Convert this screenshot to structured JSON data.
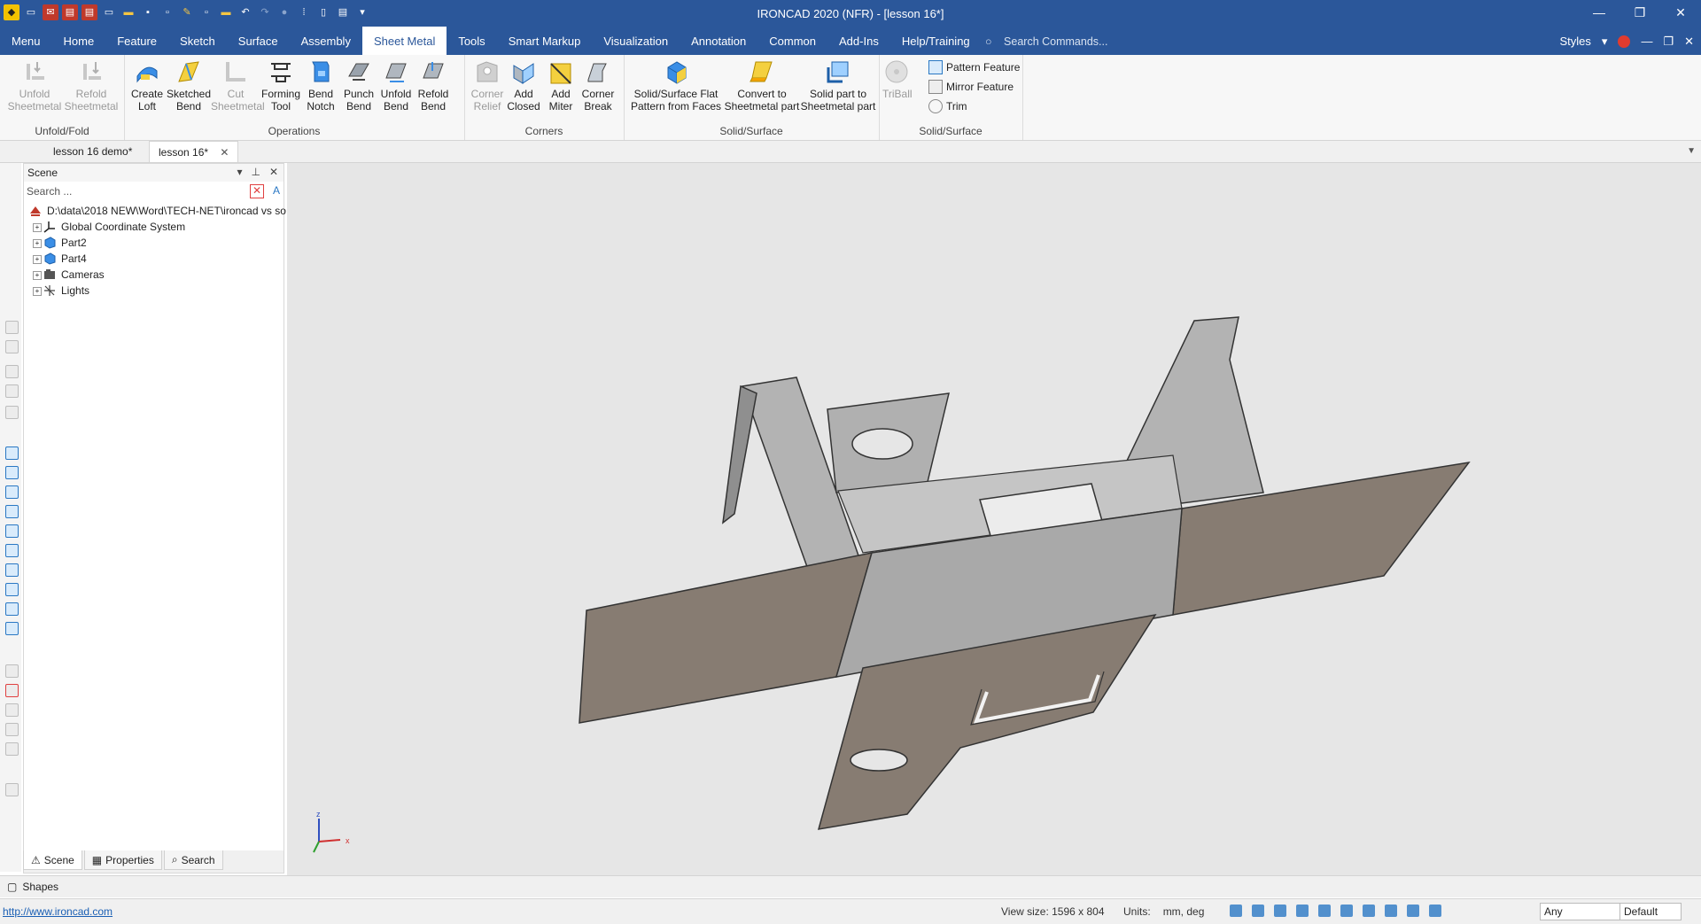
{
  "window": {
    "title": "IRONCAD 2020 (NFR) - [lesson 16*]",
    "controls": [
      "—",
      "❐",
      "✕"
    ]
  },
  "menu": {
    "tabs": [
      {
        "label": "Menu"
      },
      {
        "label": "Home"
      },
      {
        "label": "Feature"
      },
      {
        "label": "Sketch"
      },
      {
        "label": "Surface"
      },
      {
        "label": "Assembly"
      },
      {
        "label": "Sheet Metal"
      },
      {
        "label": "Tools"
      },
      {
        "label": "Smart Markup"
      },
      {
        "label": "Visualization"
      },
      {
        "label": "Annotation"
      },
      {
        "label": "Common"
      },
      {
        "label": "Add-Ins"
      },
      {
        "label": "Help/Training"
      }
    ],
    "active_tab": "Sheet Metal",
    "search_placeholder": "Search Commands...",
    "styles_label": "Styles"
  },
  "ribbon": {
    "groups": {
      "unfold_fold": "Unfold/Fold",
      "operations": "Operations",
      "corners": "Corners",
      "solid_surface_1": "Solid/Surface",
      "solid_surface_2": "Solid/Surface"
    },
    "buttons": {
      "unfold_sheetmetal": [
        "Unfold",
        "Sheetmetal"
      ],
      "refold_sheetmetal": [
        "Refold",
        "Sheetmetal"
      ],
      "create_loft": [
        "Create",
        "Loft"
      ],
      "sketched_bend": [
        "Sketched",
        "Bend"
      ],
      "cut_sheetmetal": [
        "Cut",
        "Sheetmetal"
      ],
      "forming_tool": [
        "Forming",
        "Tool"
      ],
      "bend_notch": [
        "Bend",
        "Notch"
      ],
      "punch_bend": [
        "Punch",
        "Bend"
      ],
      "unfold_bend": [
        "Unfold",
        "Bend"
      ],
      "refold_bend": [
        "Refold",
        "Bend"
      ],
      "corner_relief": [
        "Corner",
        "Relief"
      ],
      "add_closed": [
        "Add",
        "Closed"
      ],
      "add_miter": [
        "Add",
        "Miter"
      ],
      "corner_break": [
        "Corner",
        "Break"
      ],
      "flat_pattern": [
        "Solid/Surface Flat",
        "Pattern from Faces"
      ],
      "convert_sheetmetal": [
        "Convert to",
        "Sheetmetal part"
      ],
      "solid_to_sheetmetal": [
        "Solid part to",
        "Sheetmetal part"
      ],
      "triball": "TriBall",
      "pattern_feature": "Pattern Feature",
      "mirror_feature": "Mirror Feature",
      "trim": "Trim"
    }
  },
  "doc_tabs": [
    {
      "label": "lesson 16 demo*"
    },
    {
      "label": "lesson 16*"
    }
  ],
  "scene": {
    "title": "Scene",
    "search_placeholder": "Search ...",
    "root": "D:\\data\\2018 NEW\\Word\\TECH-NET\\ironcad vs so",
    "items": [
      {
        "label": "Global Coordinate System"
      },
      {
        "label": "Part2"
      },
      {
        "label": "Part4"
      },
      {
        "label": "Cameras"
      },
      {
        "label": "Lights"
      }
    ],
    "bottom_tabs": [
      "Scene",
      "Properties",
      "Search"
    ]
  },
  "triad": {
    "z": "z",
    "x": "x"
  },
  "shapes_label": "Shapes",
  "status": {
    "url": "http://www.ironcad.com",
    "view_size": "View size: 1596 x   804",
    "units_label": "Units:",
    "units_value": "mm, deg",
    "filter_value": "Any",
    "style_value": "Default"
  },
  "colors": {
    "title_bg": "#2b579a",
    "part_top": "#8a7b6e",
    "part_side": "#b8b8b8",
    "viewport_bg": "#e6e6e6"
  }
}
